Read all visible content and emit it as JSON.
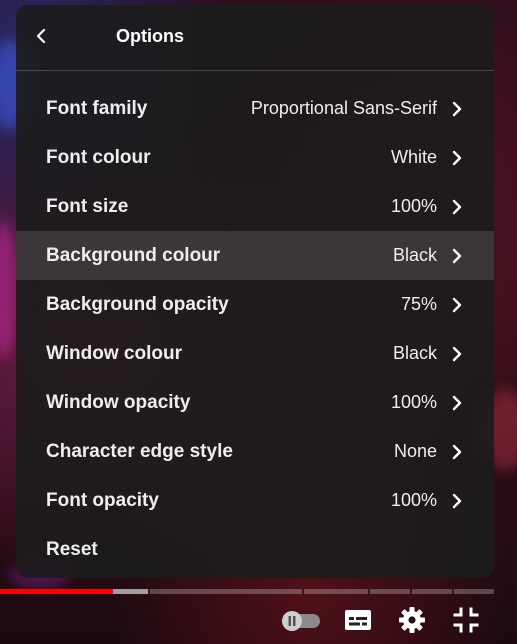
{
  "panel": {
    "title": "Options",
    "back_icon": "chevron-left-icon",
    "rows": [
      {
        "label": "Font family",
        "value": "Proportional Sans-Serif",
        "icon": "chevron-right-icon"
      },
      {
        "label": "Font colour",
        "value": "White",
        "icon": "chevron-right-icon"
      },
      {
        "label": "Font size",
        "value": "100%",
        "icon": "chevron-right-icon"
      },
      {
        "label": "Background colour",
        "value": "Black",
        "icon": "chevron-right-icon",
        "highlighted": true
      },
      {
        "label": "Background opacity",
        "value": "75%",
        "icon": "chevron-right-icon"
      },
      {
        "label": "Window colour",
        "value": "Black",
        "icon": "chevron-right-icon"
      },
      {
        "label": "Window opacity",
        "value": "100%",
        "icon": "chevron-right-icon"
      },
      {
        "label": "Character edge style",
        "value": "None",
        "icon": "chevron-right-icon"
      },
      {
        "label": "Font opacity",
        "value": "100%",
        "icon": "chevron-right-icon"
      },
      {
        "label": "Reset"
      }
    ]
  },
  "player": {
    "progress": {
      "played_fraction": 0.228,
      "buffered_fraction": 0.3,
      "played_color": "#ff0000"
    },
    "controls": [
      {
        "name": "autoplay-toggle",
        "icon": "pause-toggle-icon",
        "state": "paused"
      },
      {
        "name": "subtitles-button",
        "icon": "subtitles-icon"
      },
      {
        "name": "settings-button",
        "icon": "gear-icon"
      },
      {
        "name": "exit-fullscreen-button",
        "icon": "exit-fullscreen-icon"
      }
    ]
  },
  "colors": {
    "panel_bg": "#1c1c1c",
    "text": "#eeeeee",
    "accent_red": "#ff0000"
  }
}
